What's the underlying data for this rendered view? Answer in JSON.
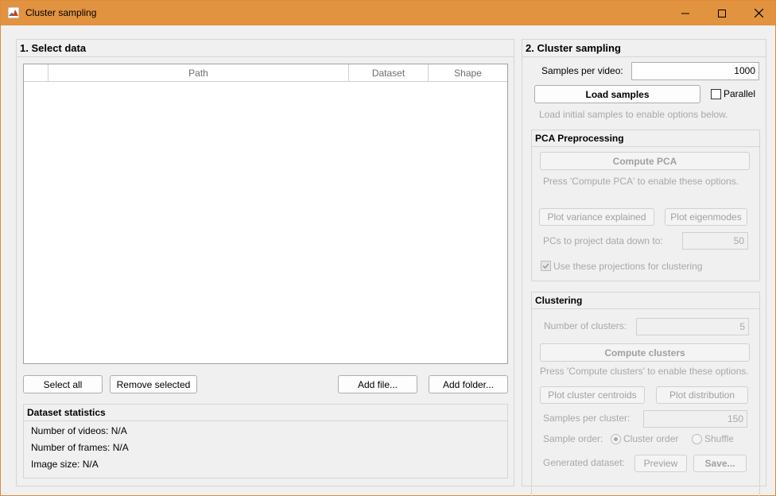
{
  "window": {
    "title": "Cluster sampling",
    "minimize": "—",
    "maximize": "☐",
    "close": "✕",
    "titlebar_color": "#e19340"
  },
  "select_data": {
    "title": "1. Select data",
    "columns": [
      "",
      "Path",
      "Dataset",
      "Shape"
    ],
    "rows": [],
    "buttons": {
      "select_all": "Select all",
      "remove_selected": "Remove selected",
      "add_file": "Add file...",
      "add_folder": "Add folder..."
    },
    "stats": {
      "title": "Dataset statistics",
      "num_videos": "Number of videos: N/A",
      "num_frames": "Number of frames: N/A",
      "image_size": "Image size: N/A"
    }
  },
  "cluster_sampling": {
    "title": "2. Cluster sampling",
    "samples_per_video_label": "Samples per video:",
    "samples_per_video_value": "1000",
    "load_samples": "Load samples",
    "parallel_label": "Parallel",
    "parallel_checked": false,
    "hint": "Load initial samples to enable options below.",
    "pca": {
      "title": "PCA Preprocessing",
      "compute_pca": "Compute PCA",
      "hint": "Press 'Compute PCA' to enable these options.",
      "plot_variance": "Plot variance explained",
      "plot_eigenmodes": "Plot eigenmodes",
      "pcs_label": "PCs to project data down to:",
      "pcs_value": "50",
      "use_projections_label": "Use these projections for clustering",
      "use_projections_checked": true
    },
    "clustering": {
      "title": "Clustering",
      "num_clusters_label": "Number of clusters:",
      "num_clusters_value": "5",
      "compute_clusters": "Compute clusters",
      "hint": "Press 'Compute clusters' to enable these options.",
      "plot_centroids": "Plot cluster centroids",
      "plot_distribution": "Plot distribution",
      "samples_per_cluster_label": "Samples per cluster:",
      "samples_per_cluster_value": "150",
      "sample_order_label": "Sample order:",
      "order_cluster": "Cluster order",
      "order_shuffle": "Shuffle",
      "generated_label": "Generated dataset:",
      "preview": "Preview",
      "save": "Save..."
    }
  }
}
